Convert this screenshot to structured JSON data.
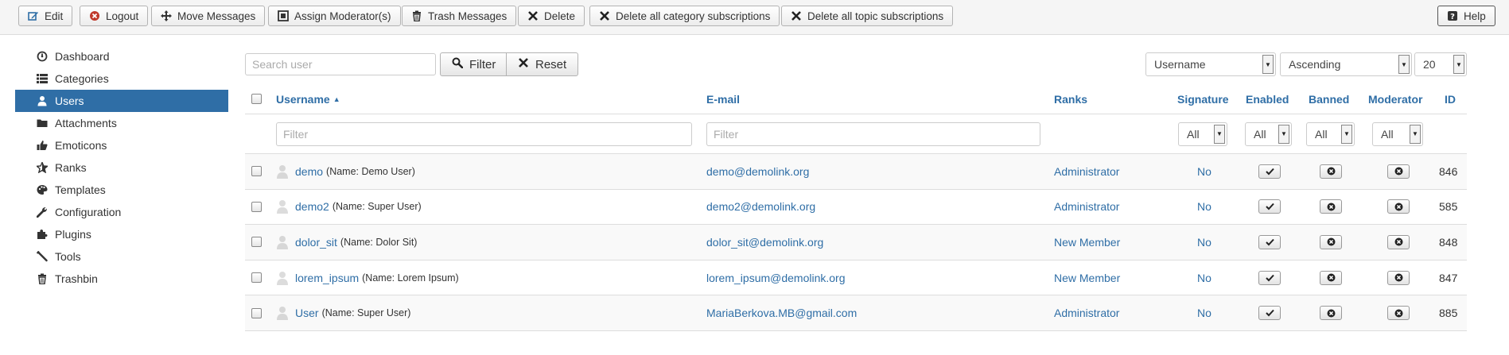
{
  "toolbar": {
    "edit": "Edit",
    "logout": "Logout",
    "move_messages": "Move Messages",
    "assign_moderator": "Assign Moderator(s)",
    "trash_messages": "Trash Messages",
    "delete": "Delete",
    "delete_category_subs": "Delete all category subscriptions",
    "delete_topic_subs": "Delete all topic subscriptions",
    "help": "Help"
  },
  "sidebar": {
    "items": [
      {
        "label": "Dashboard",
        "icon": "dashboard-icon"
      },
      {
        "label": "Categories",
        "icon": "list-icon"
      },
      {
        "label": "Users",
        "icon": "user-icon",
        "active": true
      },
      {
        "label": "Attachments",
        "icon": "folder-icon"
      },
      {
        "label": "Emoticons",
        "icon": "thumbs-up-icon"
      },
      {
        "label": "Ranks",
        "icon": "star-icon"
      },
      {
        "label": "Templates",
        "icon": "palette-icon"
      },
      {
        "label": "Configuration",
        "icon": "wrench-icon"
      },
      {
        "label": "Plugins",
        "icon": "puzzle-icon"
      },
      {
        "label": "Tools",
        "icon": "tools-icon"
      },
      {
        "label": "Trashbin",
        "icon": "trash-icon"
      }
    ]
  },
  "filters": {
    "search_placeholder": "Search user",
    "filter_label": "Filter",
    "reset_label": "Reset",
    "sort_field": "Username",
    "sort_direction": "Ascending",
    "page_size": "20"
  },
  "table": {
    "headers": {
      "username": "Username",
      "email": "E-mail",
      "ranks": "Ranks",
      "signature": "Signature",
      "enabled": "Enabled",
      "banned": "Banned",
      "moderator": "Moderator",
      "id": "ID"
    },
    "column_filters": {
      "username_placeholder": "Filter",
      "email_placeholder": "Filter",
      "signature": "All",
      "enabled": "All",
      "banned": "All",
      "moderator": "All"
    },
    "rows": [
      {
        "username": "demo",
        "name": "(Name: Demo User)",
        "email": "demo@demolink.org",
        "rank": "Administrator",
        "signature": "No",
        "id": "846"
      },
      {
        "username": "demo2",
        "name": "(Name: Super User)",
        "email": "demo2@demolink.org",
        "rank": "Administrator",
        "signature": "No",
        "id": "585"
      },
      {
        "username": "dolor_sit",
        "name": "(Name: Dolor Sit)",
        "email": "dolor_sit@demolink.org",
        "rank": "New Member",
        "signature": "No",
        "id": "848"
      },
      {
        "username": "lorem_ipsum",
        "name": "(Name: Lorem Ipsum)",
        "email": "lorem_ipsum@demolink.org",
        "rank": "New Member",
        "signature": "No",
        "id": "847"
      },
      {
        "username": "User",
        "name": "(Name: Super User)",
        "email": "MariaBerkova.MB@gmail.com",
        "rank": "Administrator",
        "signature": "No",
        "id": "885"
      }
    ]
  },
  "colors": {
    "accent": "#2f6ea6",
    "logout_red": "#c0392b"
  }
}
